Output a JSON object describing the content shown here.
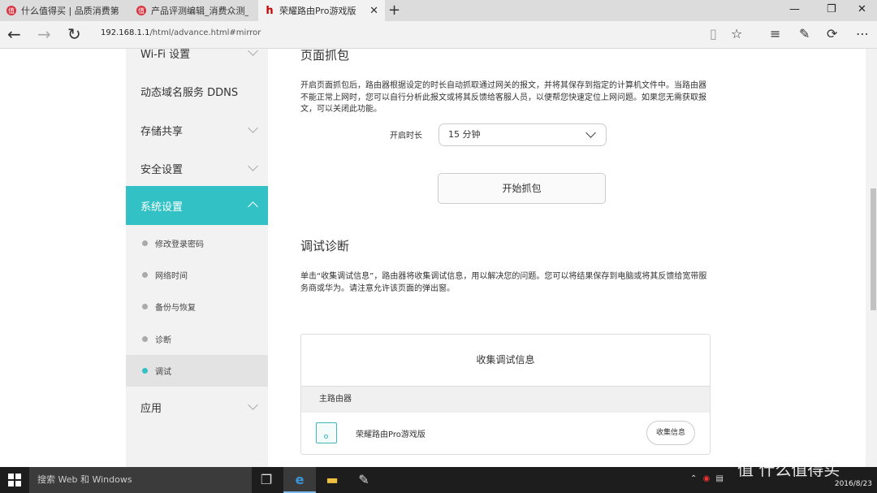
{
  "browser": {
    "tabs": [
      {
        "title": "什么值得买 | 品质消费第一站"
      },
      {
        "title": "产品评测编辑_消费众测_什么值得买"
      },
      {
        "title": "荣耀路由Pro游戏版"
      }
    ],
    "tab_icons": [
      "值",
      "值",
      "h"
    ],
    "url_prefix": "192.168.1.1",
    "url_rest": "/html/advance.html#mirror"
  },
  "sidebar": {
    "items": [
      {
        "label": "Wi-Fi 设置"
      },
      {
        "label": "动态域名服务 DDNS"
      },
      {
        "label": "存储共享"
      },
      {
        "label": "安全设置"
      },
      {
        "label": "系统设置"
      },
      {
        "label": "应用"
      }
    ],
    "sub_items": [
      {
        "label": "修改登录密码"
      },
      {
        "label": "网络时间"
      },
      {
        "label": "备份与恢复"
      },
      {
        "label": "诊断"
      },
      {
        "label": "调试"
      }
    ]
  },
  "main": {
    "capture": {
      "title": "页面抓包",
      "description": "开启页面抓包后，路由器根据设定的时长自动抓取通过网关的报文，并将其保存到指定的计算机文件中。当路由器不能正常上网时，您可以自行分析此报文或将其反馈给客服人员，以便帮您快速定位上网问题。如果您无需获取报文，可以关闭此功能。",
      "duration_label": "开启时长",
      "duration_value": "15 分钟",
      "start_button": "开始抓包"
    },
    "debug": {
      "title": "调试诊断",
      "description": "单击“收集调试信息”，路由器将收集调试信息，用以解决您的问题。您可以将结果保存到电脑或将其反馈给宽带服务商或华为。请注意允许该页面的弹出窗。",
      "card_title": "收集调试信息",
      "section_label": "主路由器",
      "router_name": "荣耀路由Pro游戏版",
      "collect_button": "收集信息"
    }
  },
  "taskbar": {
    "search_placeholder": "搜索 Web 和 Windows",
    "date": "2016/8/23",
    "watermark": "值 什么值得买"
  }
}
